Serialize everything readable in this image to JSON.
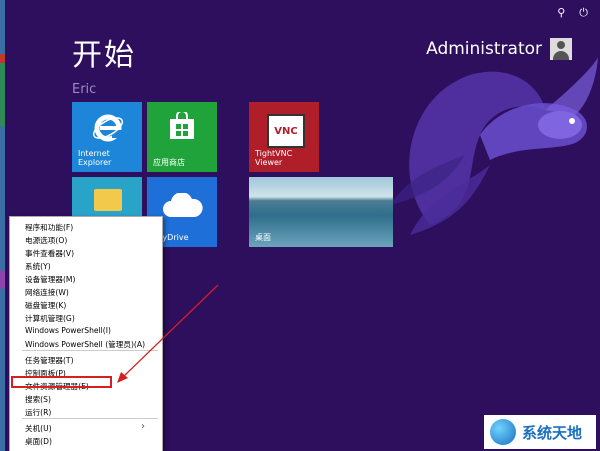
{
  "start": {
    "title": "开始",
    "group_label": "Eric",
    "user_name": "Administrator"
  },
  "tiles": {
    "ie_label": "Internet\nExplorer",
    "store_label": "应用商店",
    "vnc_label": "TightVNC\nViewer",
    "vnc_logo_text": "VNC",
    "skydrive_label": "SkyDrive",
    "desktop_label": "桌面"
  },
  "context_menu": {
    "items": [
      "程序和功能(F)",
      "电源选项(O)",
      "事件查看器(V)",
      "系统(Y)",
      "设备管理器(M)",
      "网络连接(W)",
      "磁盘管理(K)",
      "计算机管理(G)",
      "Windows PowerShell(I)",
      "Windows PowerShell (管理员)(A)",
      "任务管理器(T)",
      "控制面板(P)",
      "文件资源管理器(E)",
      "搜索(S)",
      "运行(R)",
      "关机(U)",
      "桌面(D)"
    ],
    "highlighted_item": "文件资源管理器(E)"
  },
  "watermark": {
    "text": "系统天地"
  },
  "colors": {
    "background": "#2d0f5e",
    "ie_tile": "#1e86d8",
    "store_tile": "#20a33b",
    "vnc_tile": "#b01e2a",
    "skydrive_tile": "#1e6fd8",
    "highlight_box": "#d61f1f"
  }
}
